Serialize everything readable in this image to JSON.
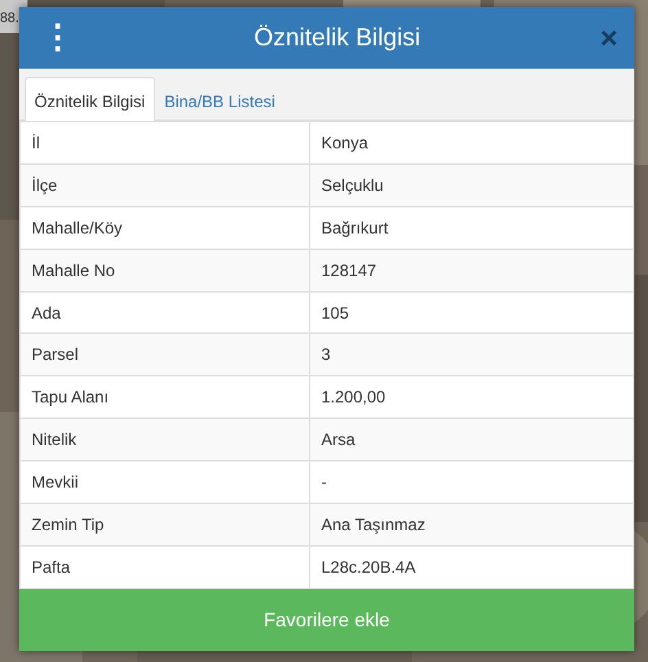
{
  "map_label": "88.",
  "modal": {
    "title": "Öznitelik Bilgisi",
    "menu_glyph": "⋮",
    "close_glyph": "×"
  },
  "tabs": [
    {
      "label": "Öznitelik Bilgisi",
      "selected": true
    },
    {
      "label": "Bina/BB Listesi",
      "selected": false
    }
  ],
  "table": {
    "rows": [
      {
        "label": "İl",
        "value": "Konya"
      },
      {
        "label": "İlçe",
        "value": "Selçuklu"
      },
      {
        "label": "Mahalle/Köy",
        "value": "Bağrıkurt"
      },
      {
        "label": "Mahalle No",
        "value": "128147"
      },
      {
        "label": "Ada",
        "value": "105"
      },
      {
        "label": "Parsel",
        "value": "3"
      },
      {
        "label": "Tapu Alanı",
        "value": "1.200,00"
      },
      {
        "label": "Nitelik",
        "value": "Arsa"
      },
      {
        "label": "Mevkii",
        "value": "-"
      },
      {
        "label": "Zemin Tip",
        "value": "Ana Taşınmaz"
      },
      {
        "label": "Pafta",
        "value": "L28c.20B.4A"
      }
    ]
  },
  "button": "Favorilere ekle"
}
